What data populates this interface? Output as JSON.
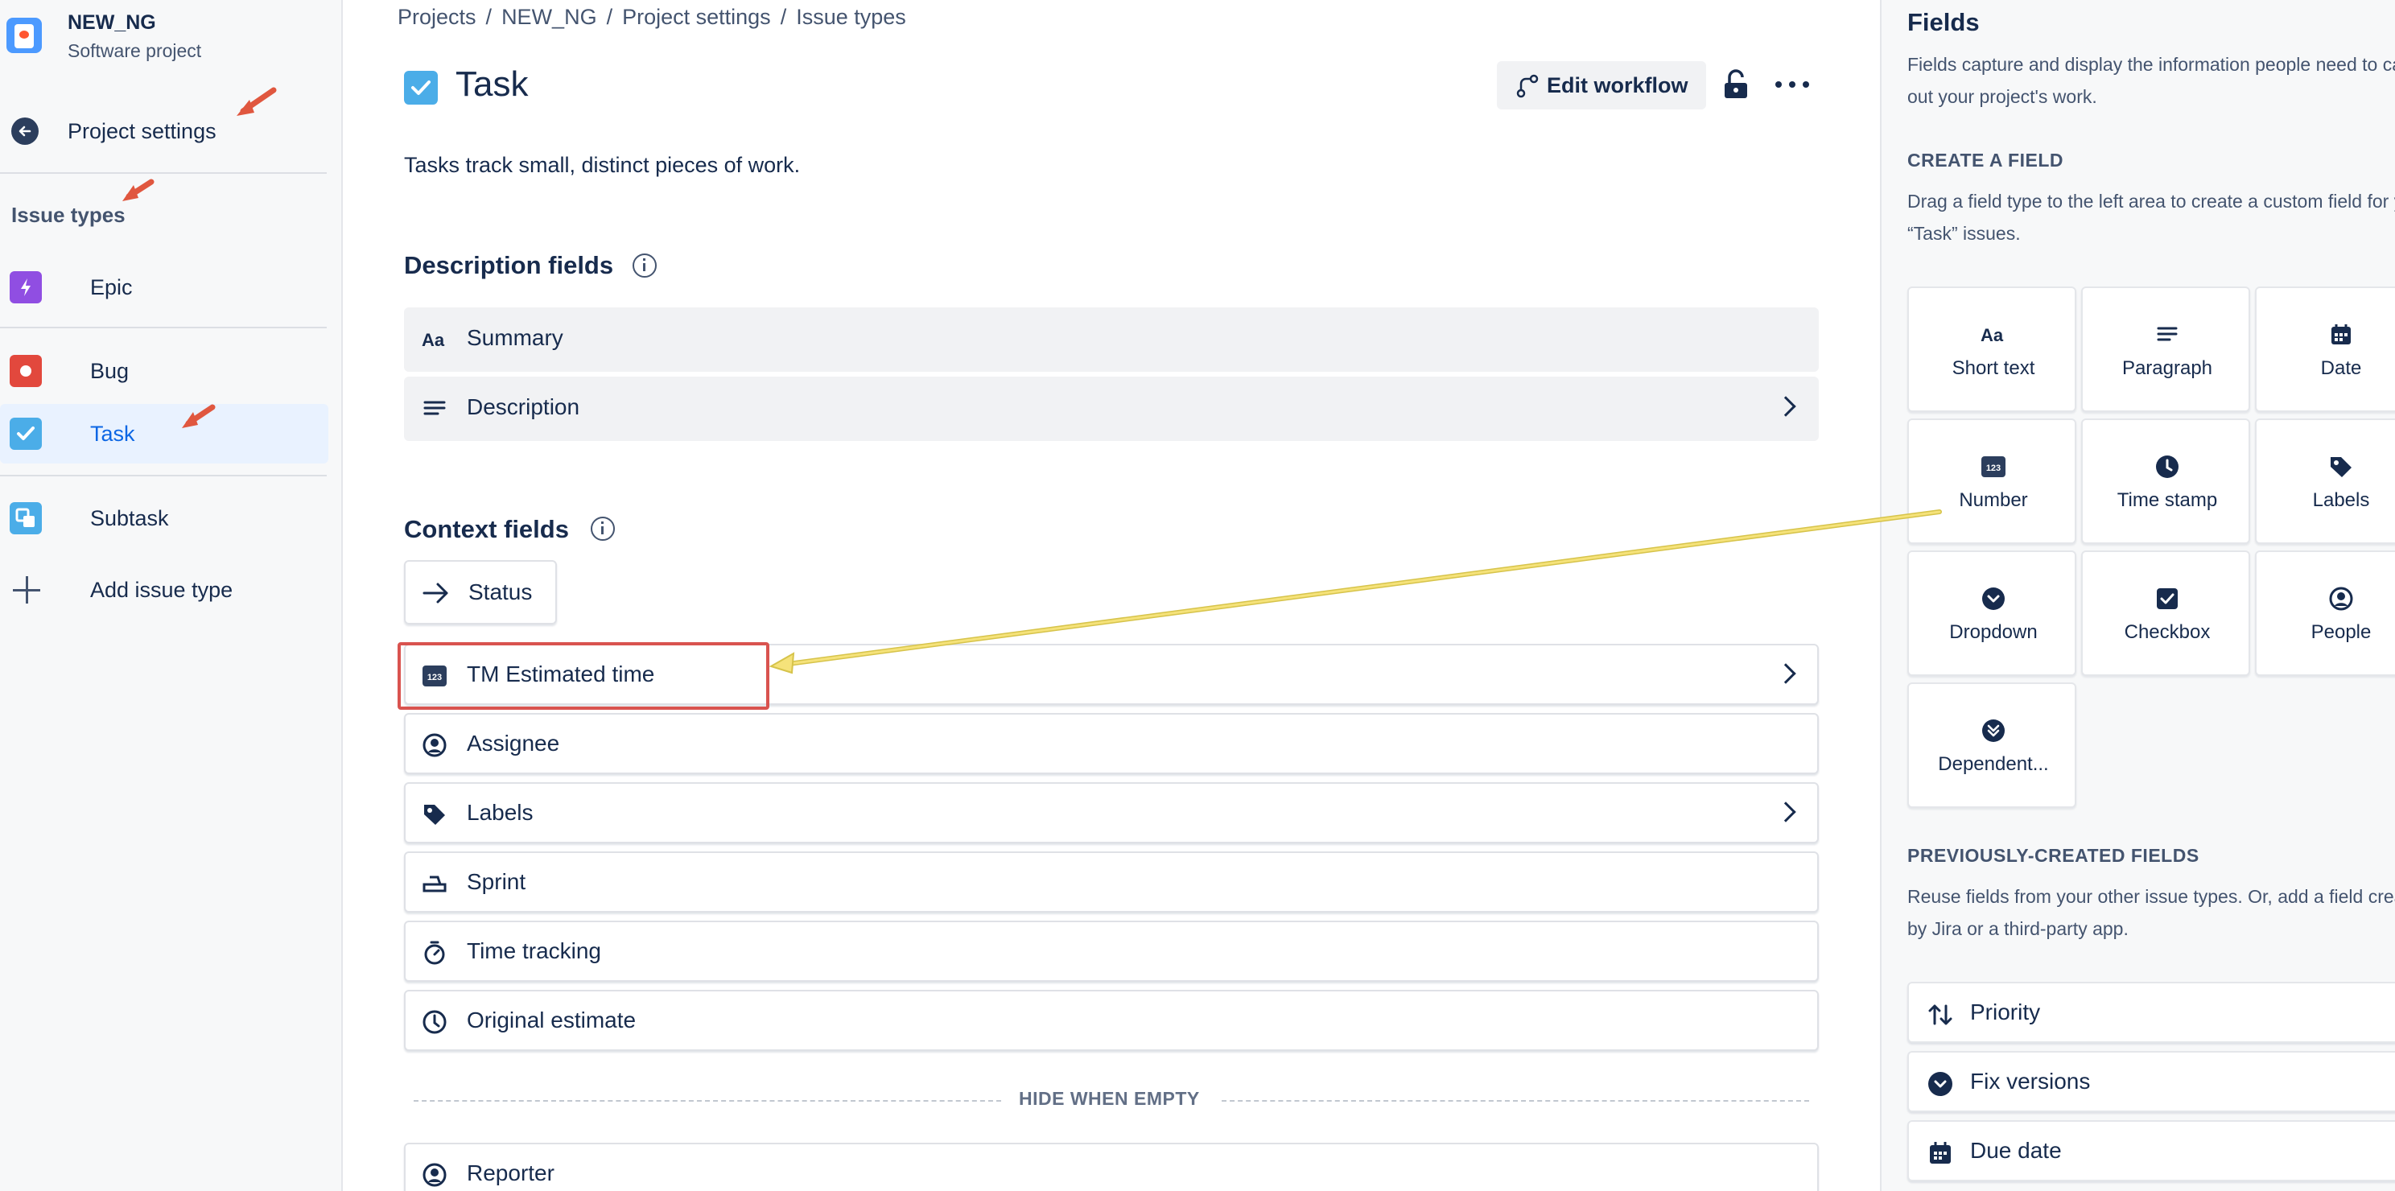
{
  "project": {
    "name": "NEW_NG",
    "type": "Software project"
  },
  "sidebar": {
    "back_label": "Project settings",
    "section_title": "Issue types",
    "items": [
      {
        "label": "Epic",
        "icon": "epic-icon"
      },
      {
        "label": "Bug",
        "icon": "bug-icon"
      },
      {
        "label": "Task",
        "icon": "task-icon",
        "active": true
      },
      {
        "label": "Subtask",
        "icon": "subtask-icon"
      }
    ],
    "add_label": "Add issue type"
  },
  "breadcrumb": [
    "Projects",
    "NEW_NG",
    "Project settings",
    "Issue types"
  ],
  "header": {
    "title": "Task",
    "edit_workflow": "Edit workflow",
    "description": "Tasks track small, distinct pieces of work."
  },
  "description_fields": {
    "title": "Description fields",
    "items": [
      {
        "label": "Summary",
        "icon": "text-format-icon"
      },
      {
        "label": "Description",
        "icon": "paragraph-icon"
      }
    ]
  },
  "context_fields": {
    "title": "Context fields",
    "status": "Status",
    "items": [
      {
        "label": "TM Estimated time",
        "icon": "number-icon"
      },
      {
        "label": "Assignee",
        "icon": "person-icon"
      },
      {
        "label": "Labels",
        "icon": "label-icon"
      },
      {
        "label": "Sprint",
        "icon": "sprint-icon"
      },
      {
        "label": "Time tracking",
        "icon": "stopwatch-icon"
      },
      {
        "label": "Original estimate",
        "icon": "clock-icon"
      }
    ],
    "hide_when_empty": "HIDE WHEN EMPTY",
    "hidden_items": [
      {
        "label": "Reporter",
        "icon": "person-icon"
      }
    ]
  },
  "right_panel": {
    "title": "Fields",
    "intro": "Fields capture and display the information people need to carry out your project's work.",
    "create_title": "CREATE A FIELD",
    "create_text": "Drag a field type to the left area to create a custom field for your “Task” issues.",
    "tiles": [
      {
        "label": "Short text",
        "icon": "text-format-icon"
      },
      {
        "label": "Paragraph",
        "icon": "paragraph-icon"
      },
      {
        "label": "Date",
        "icon": "calendar-icon"
      },
      {
        "label": "Number",
        "icon": "number-icon"
      },
      {
        "label": "Time stamp",
        "icon": "clock-icon"
      },
      {
        "label": "Labels",
        "icon": "label-icon"
      },
      {
        "label": "Dropdown",
        "icon": "dropdown-icon"
      },
      {
        "label": "Checkbox",
        "icon": "checkbox-icon"
      },
      {
        "label": "People",
        "icon": "person-icon"
      },
      {
        "label": "Dependent...",
        "icon": "dependent-dropdown-icon"
      }
    ],
    "prev_title": "PREVIOUSLY-CREATED FIELDS",
    "prev_text": "Reuse fields from your other issue types. Or, add a field created by Jira or a third-party app.",
    "prev_items": [
      {
        "label": "Priority",
        "icon": "priority-icon"
      },
      {
        "label": "Fix versions",
        "icon": "dropdown-icon"
      },
      {
        "label": "Due date",
        "icon": "calendar-icon"
      }
    ]
  },
  "colors": {
    "accent": "#0c66e4",
    "annotation_red": "#d9534f",
    "annotation_arrow": "#f5e27a"
  }
}
